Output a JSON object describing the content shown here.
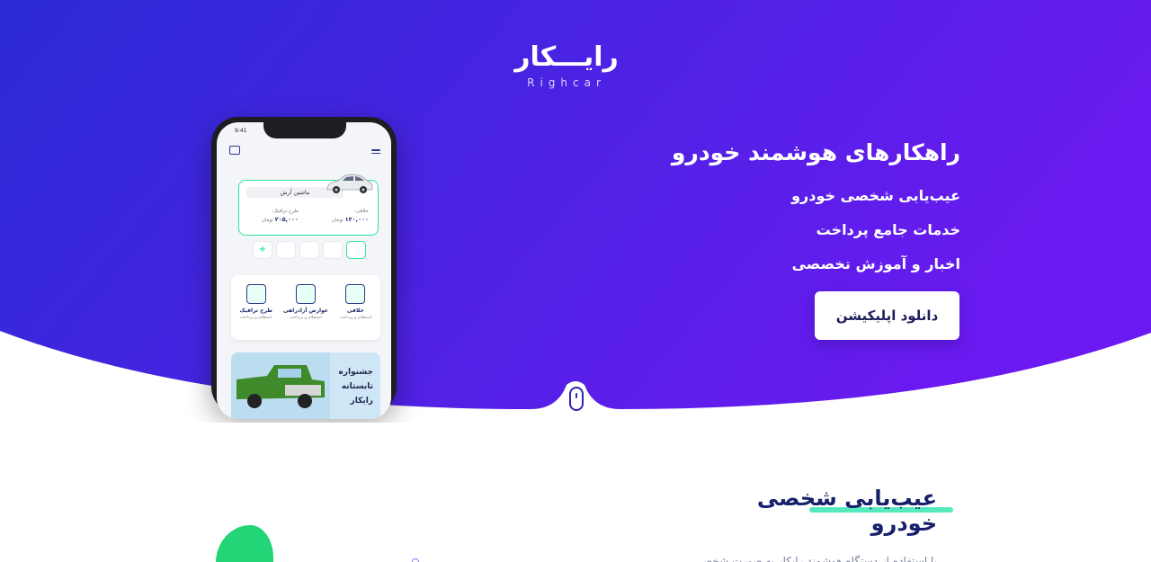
{
  "logo": {
    "fa": "رایـــکار",
    "en": "Righcar"
  },
  "hero": {
    "title": "راهکارهای هوشمند خودرو",
    "features": [
      "عیب‌یابی شخصی خودرو",
      "خدمات جامع پرداخت",
      "اخبار و آموزش تخصصی"
    ],
    "download_label": "دانلود اپلیکیشن"
  },
  "phone": {
    "status_time": "9:41",
    "car_name": "ماشین آرش",
    "col_right_label": "خلافی:",
    "col_right_value": "۱۲۰,۰۰۰",
    "col_right_unit": "تومان",
    "col_left_label": "طرح ترافیک:",
    "col_left_value": "۲۰۵,۰۰۰",
    "col_left_unit": "تومان",
    "add_label": "+",
    "services": [
      {
        "title": "خلافی",
        "sub": "استعلام و پرداخت"
      },
      {
        "title": "عوارض آزادراهی",
        "sub": "استعلام و پرداخت"
      },
      {
        "title": "طرح ترافیک",
        "sub": "استعلام و پرداخت"
      }
    ],
    "promo_text": "جشنواره تابستانه رایکار"
  },
  "section": {
    "title": "عیب‌یابی شخصی خودرو",
    "body": "با استفاده از دستگاه هوشمند رایکار به صورت شخصی"
  },
  "colors": {
    "gradient_start": "#2b2bd6",
    "gradient_end": "#6a1af0",
    "accent_green": "#42e7b6",
    "title_navy": "#17206b"
  }
}
